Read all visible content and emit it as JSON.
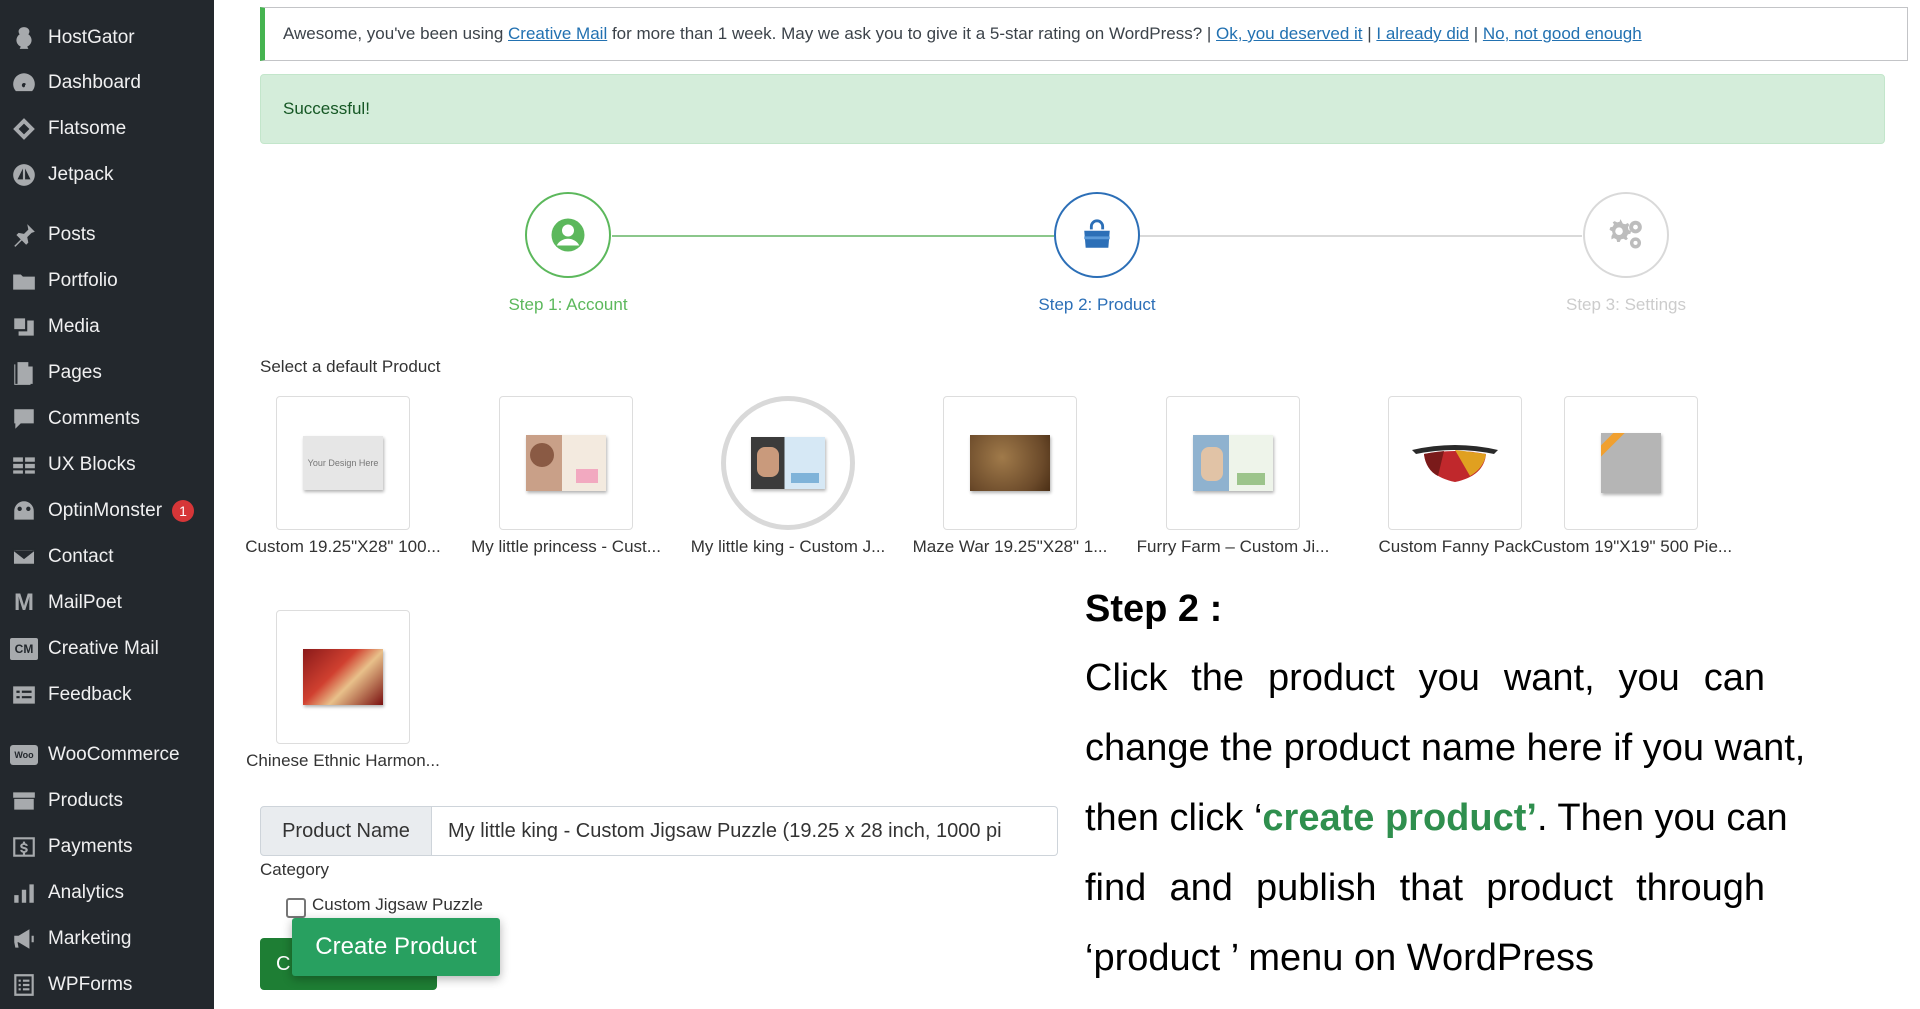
{
  "sidebar": {
    "items": [
      {
        "label": "HostGator",
        "icon": "hostgator-icon"
      },
      {
        "label": "Dashboard",
        "icon": "dashboard-icon"
      },
      {
        "label": "Flatsome",
        "icon": "flatsome-icon"
      },
      {
        "label": "Jetpack",
        "icon": "jetpack-icon"
      },
      {
        "label": "Posts",
        "icon": "pin-icon"
      },
      {
        "label": "Portfolio",
        "icon": "folder-icon"
      },
      {
        "label": "Media",
        "icon": "media-icon"
      },
      {
        "label": "Pages",
        "icon": "pages-icon"
      },
      {
        "label": "Comments",
        "icon": "comment-icon"
      },
      {
        "label": "UX Blocks",
        "icon": "blocks-icon"
      },
      {
        "label": "OptinMonster",
        "icon": "optinmonster-icon",
        "badge": "1"
      },
      {
        "label": "Contact",
        "icon": "mail-icon"
      },
      {
        "label": "MailPoet",
        "icon": "mailpoet-icon",
        "glyph": "M"
      },
      {
        "label": "Creative Mail",
        "icon": "creative-mail-icon",
        "glyph": "CM"
      },
      {
        "label": "Feedback",
        "icon": "feedback-icon"
      },
      {
        "label": "WooCommerce",
        "icon": "woocommerce-icon",
        "glyph": "Woo"
      },
      {
        "label": "Products",
        "icon": "archive-icon"
      },
      {
        "label": "Payments",
        "icon": "dollar-icon"
      },
      {
        "label": "Analytics",
        "icon": "chart-icon"
      },
      {
        "label": "Marketing",
        "icon": "megaphone-icon"
      },
      {
        "label": "WPForms",
        "icon": "forms-icon"
      }
    ]
  },
  "notice": {
    "text_before": "Awesome, you've been using ",
    "link_creative_mail": "Creative Mail",
    "text_after": " for more than 1 week. May we ask you to give it a 5-star rating on WordPress? | ",
    "link_deserved": "Ok, you deserved it",
    "sep1": " | ",
    "link_already": "I already did",
    "sep2": " | ",
    "link_not_good": "No, not good enough"
  },
  "success": {
    "text": "Successful!"
  },
  "steps": [
    {
      "label": "Step 1: Account",
      "state": "done",
      "color": "#5cb85c"
    },
    {
      "label": "Step 2: Product",
      "state": "active",
      "color": "#2c6fb7"
    },
    {
      "label": "Step 3: Settings",
      "state": "todo",
      "color": "#cccccc"
    }
  ],
  "products_section": {
    "label": "Select a default Product"
  },
  "products": [
    {
      "name": "Custom 19.25\"X28\" 100...",
      "thumb_text": "Your Design Here"
    },
    {
      "name": "My little princess - Cust..."
    },
    {
      "name": "My little king - Custom J...",
      "selected": true
    },
    {
      "name": "Maze War 19.25\"X28\" 1..."
    },
    {
      "name": "Furry Farm – Custom Ji..."
    },
    {
      "name": "Custom Fanny Pack"
    },
    {
      "name": "Custom 19\"X19\" 500 Pie..."
    },
    {
      "name": "Chinese Ethnic Harmon..."
    }
  ],
  "form": {
    "product_name_label": "Product Name",
    "product_name_value": "My little king - Custom Jigsaw Puzzle (19.25 x 28 inch, 1000 pi",
    "category_label": "Category",
    "category_option": "Custom Jigsaw Puzzle",
    "button_under": "C",
    "create_button": "Create Product"
  },
  "annotation": {
    "title": "Step 2 :",
    "line1": "Click the product you want, you can",
    "line2": "change the product name here if you want,",
    "line3_before": "then click ‘",
    "line3_highlight": "create product’",
    "line3_after": ". Then you can",
    "line4": "find and publish that product through",
    "line5": "‘product ’ menu on WordPress",
    "highlight_color": "#2f8f4e"
  }
}
